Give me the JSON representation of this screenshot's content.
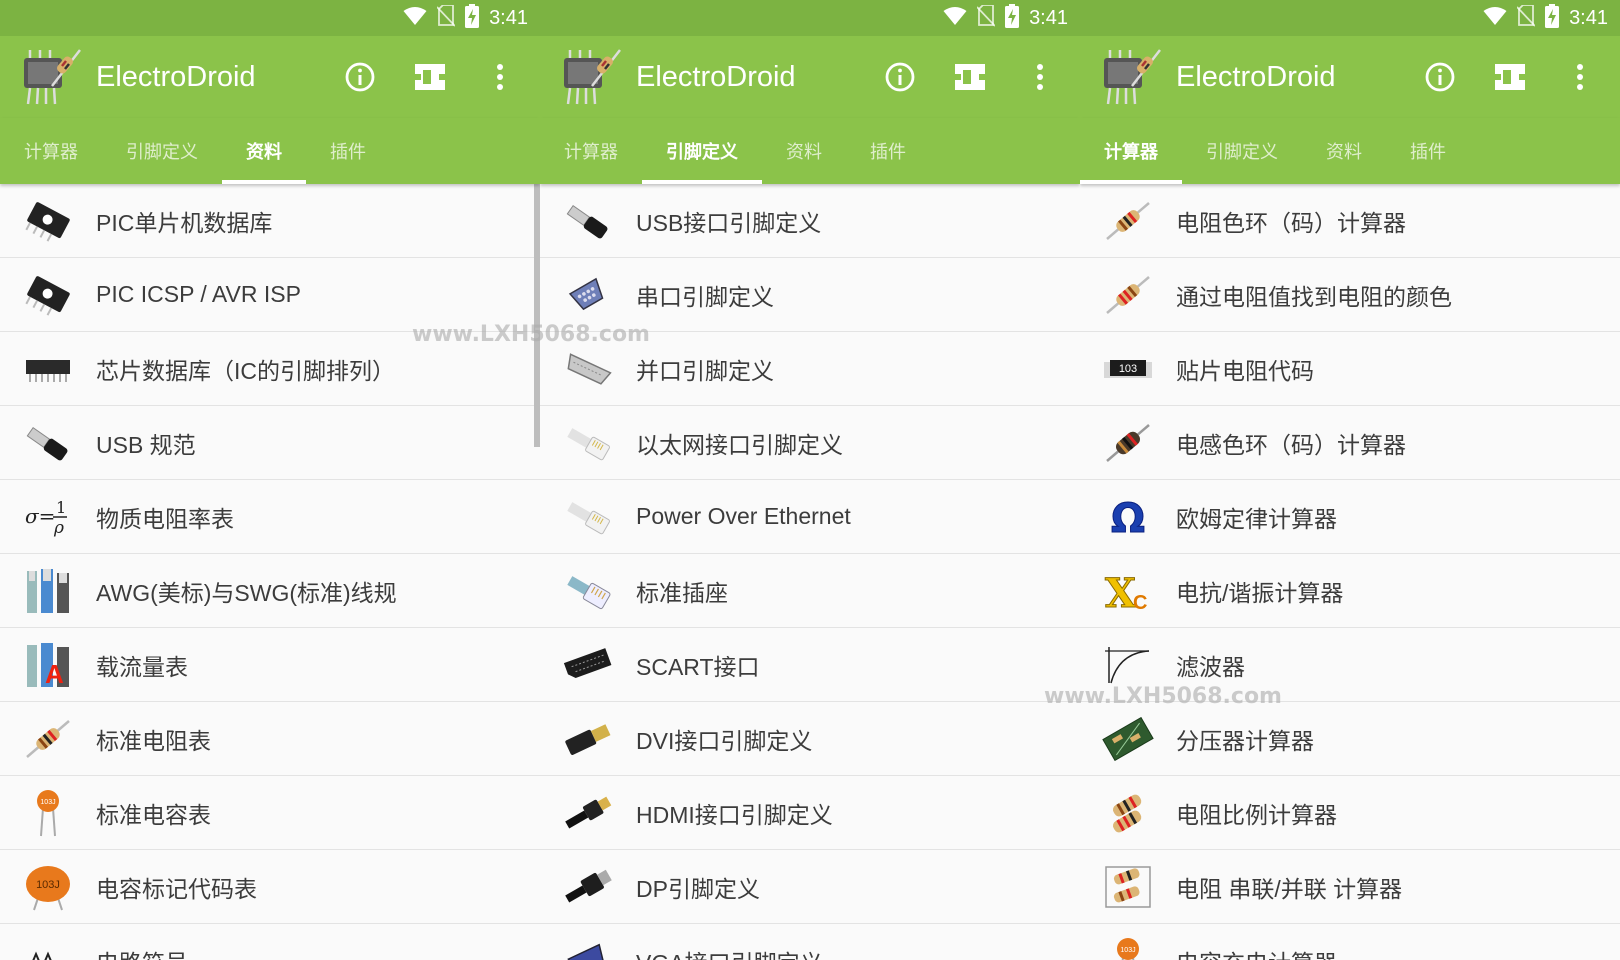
{
  "status": {
    "time": "3:41"
  },
  "app": {
    "title": "ElectroDroid"
  },
  "tabs": [
    "计算器",
    "引脚定义",
    "资料",
    "插件"
  ],
  "watermark": "www.LXH5068.com",
  "panels": [
    {
      "active_tab": 2,
      "items": [
        {
          "label": "PIC单片机数据库",
          "icon": "pic-chip-icon"
        },
        {
          "label": "PIC ICSP / AVR ISP",
          "icon": "pic-chip-icon"
        },
        {
          "label": "芯片数据库（IC的引脚排列）",
          "icon": "ic-chip-icon"
        },
        {
          "label": "USB 规范",
          "icon": "usb-plug-icon"
        },
        {
          "label": "物质电阻率表",
          "icon": "resistivity-formula-icon"
        },
        {
          "label": "AWG(美标)与SWG(标准)线规",
          "icon": "wire-gauge-icon"
        },
        {
          "label": "载流量表",
          "icon": "ampacity-icon"
        },
        {
          "label": "标准电阻表",
          "icon": "resistor-icon"
        },
        {
          "label": "标准电容表",
          "icon": "capacitor-icon"
        },
        {
          "label": "电容标记代码表",
          "icon": "capacitor-code-icon"
        },
        {
          "label": "电路符号",
          "icon": "circuit-symbol-icon"
        }
      ]
    },
    {
      "active_tab": 1,
      "items": [
        {
          "label": "USB接口引脚定义",
          "icon": "usb-plug-icon"
        },
        {
          "label": "串口引脚定义",
          "icon": "serial-port-icon"
        },
        {
          "label": "并口引脚定义",
          "icon": "parallel-port-icon"
        },
        {
          "label": "以太网接口引脚定义",
          "icon": "ethernet-plug-icon"
        },
        {
          "label": "Power Over Ethernet",
          "icon": "ethernet-plug-icon"
        },
        {
          "label": "标准插座",
          "icon": "phone-plug-icon"
        },
        {
          "label": "SCART接口",
          "icon": "scart-plug-icon"
        },
        {
          "label": "DVI接口引脚定义",
          "icon": "dvi-plug-icon"
        },
        {
          "label": "HDMI接口引脚定义",
          "icon": "hdmi-plug-icon"
        },
        {
          "label": "DP引脚定义",
          "icon": "displayport-plug-icon"
        },
        {
          "label": "VGA接口引脚定义",
          "icon": "vga-plug-icon"
        }
      ]
    },
    {
      "active_tab": 0,
      "items": [
        {
          "label": "电阻色环（码）计算器",
          "icon": "resistor-icon"
        },
        {
          "label": "通过电阻值找到电阻的颜色",
          "icon": "resistor-icon"
        },
        {
          "label": "贴片电阻代码",
          "icon": "smd-resistor-icon",
          "icon_text": "103"
        },
        {
          "label": "电感色环（码）计算器",
          "icon": "inductor-icon"
        },
        {
          "label": "欧姆定律计算器",
          "icon": "omega-icon",
          "icon_text": "Ω"
        },
        {
          "label": "电抗/谐振计算器",
          "icon": "reactance-icon",
          "icon_text": "X",
          "icon_sub": "C"
        },
        {
          "label": "滤波器",
          "icon": "filter-curve-icon"
        },
        {
          "label": "分压器计算器",
          "icon": "voltage-divider-icon"
        },
        {
          "label": "电阻比例计算器",
          "icon": "resistor-ratio-icon"
        },
        {
          "label": "电阻 串联/并联 计算器",
          "icon": "resistor-network-icon"
        },
        {
          "label": "电容充电计算器",
          "icon": "capacitor-icon"
        }
      ]
    }
  ],
  "icon_texts": {
    "capacitor": "103J",
    "resistivity_lhs": "σ=",
    "resistivity_num": "1",
    "resistivity_den": "ρ",
    "ampacity": "A"
  },
  "colors": {
    "statusbar": "#7cb342",
    "appbar": "#8bc34a",
    "text": "#3c3c3c",
    "divider": "#e3e3e3"
  }
}
